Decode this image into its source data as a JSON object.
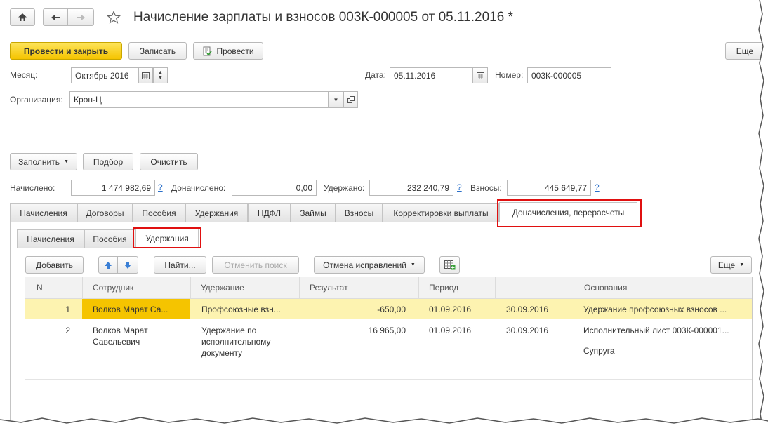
{
  "window": {
    "title": "Начисление зарплаты и взносов 003К-000005 от 05.11.2016 *"
  },
  "toolbar": {
    "post_close": "Провести и закрыть",
    "save": "Записать",
    "post": "Провести",
    "more": "Еще"
  },
  "header": {
    "month_label": "Месяц:",
    "month_value": "Октябрь 2016",
    "date_label": "Дата:",
    "date_value": "05.11.2016",
    "number_label": "Номер:",
    "number_value": "003К-000005",
    "org_label": "Организация:",
    "org_value": "Крон-Ц"
  },
  "actions": {
    "fill": "Заполнить",
    "pick": "Подбор",
    "clear": "Очистить"
  },
  "totals": {
    "accrued_label": "Начислено:",
    "accrued_value": "1 474 982,69",
    "extra_label": "Доначислено:",
    "extra_value": "0,00",
    "withheld_label": "Удержано:",
    "withheld_value": "232 240,79",
    "contrib_label": "Взносы:",
    "contrib_value": "445 649,77",
    "help": "?"
  },
  "tabs": [
    {
      "label": "Начисления"
    },
    {
      "label": "Договоры"
    },
    {
      "label": "Пособия"
    },
    {
      "label": "Удержания"
    },
    {
      "label": "НДФЛ"
    },
    {
      "label": "Займы"
    },
    {
      "label": "Взносы"
    },
    {
      "label": "Корректировки выплаты"
    },
    {
      "label": "Доначисления, перерасчеты"
    }
  ],
  "subtabs": [
    {
      "label": "Начисления"
    },
    {
      "label": "Пособия"
    },
    {
      "label": "Удержания"
    }
  ],
  "table_toolbar": {
    "add": "Добавить",
    "find": "Найти...",
    "cancel_search": "Отменить поиск",
    "cancel_fixes": "Отмена исправлений",
    "more": "Еще"
  },
  "table": {
    "columns": [
      "N",
      "Сотрудник",
      "Удержание",
      "Результат",
      "Период",
      "",
      "Основания"
    ],
    "rows": [
      {
        "n": "1",
        "employee": "Волков Марат Са...",
        "deduction": "Профсоюзные взн...",
        "result": "-650,00",
        "period_from": "01.09.2016",
        "period_to": "30.09.2016",
        "basis": "Удержание профсоюзных взносов ...",
        "basis2": ""
      },
      {
        "n": "2",
        "employee": "Волков Марат Савельевич",
        "deduction": "Удержание по исполнительному документу",
        "result": "16 965,00",
        "period_from": "01.09.2016",
        "period_to": "30.09.2016",
        "basis": "Исполнительный лист 003К-000001...",
        "basis2": "Супруга"
      }
    ]
  },
  "colors": {
    "primary_button": "#f5c400",
    "highlight_row": "#fdf3b0",
    "selected_cell": "#f5c400",
    "red_frame": "#e01010",
    "link": "#2a6fc9"
  }
}
